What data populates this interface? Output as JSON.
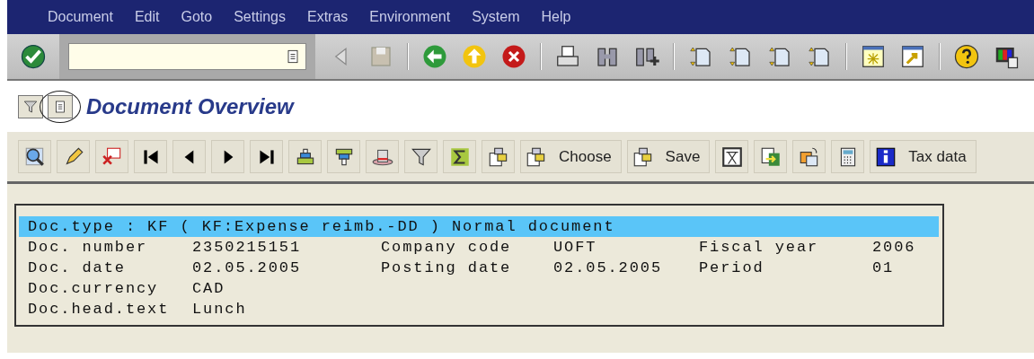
{
  "menu_bar": {
    "items": [
      {
        "label": "Document"
      },
      {
        "label": "Edit"
      },
      {
        "label": "Goto"
      },
      {
        "label": "Settings"
      },
      {
        "label": "Extras"
      },
      {
        "label": "Environment"
      },
      {
        "label": "System"
      },
      {
        "label": "Help"
      }
    ]
  },
  "title": "Document Overview",
  "app_toolbar": {
    "labelled_buttons": [
      {
        "label": "Choose"
      },
      {
        "label": "Save"
      },
      {
        "label": "Tax data"
      }
    ]
  },
  "header_panel": {
    "doc_type_line": {
      "text": "Doc.type : KF ( KF:Expense reimb.-DD ) Normal document",
      "selected": true
    },
    "rows": [
      [
        {
          "label": "Doc. number",
          "value": "2350215151"
        },
        {
          "label": "Company code",
          "value": "UOFT"
        },
        {
          "label": "Fiscal year",
          "value": "2006"
        }
      ],
      [
        {
          "label": "Doc. date",
          "value": "02.05.2005"
        },
        {
          "label": "Posting date",
          "value": "02.05.2005"
        },
        {
          "label": "Period",
          "value": "01"
        }
      ],
      [
        {
          "label": "Doc.currency",
          "value": "CAD"
        }
      ],
      [
        {
          "label": "Doc.head.text",
          "value": "Lunch"
        }
      ]
    ]
  }
}
